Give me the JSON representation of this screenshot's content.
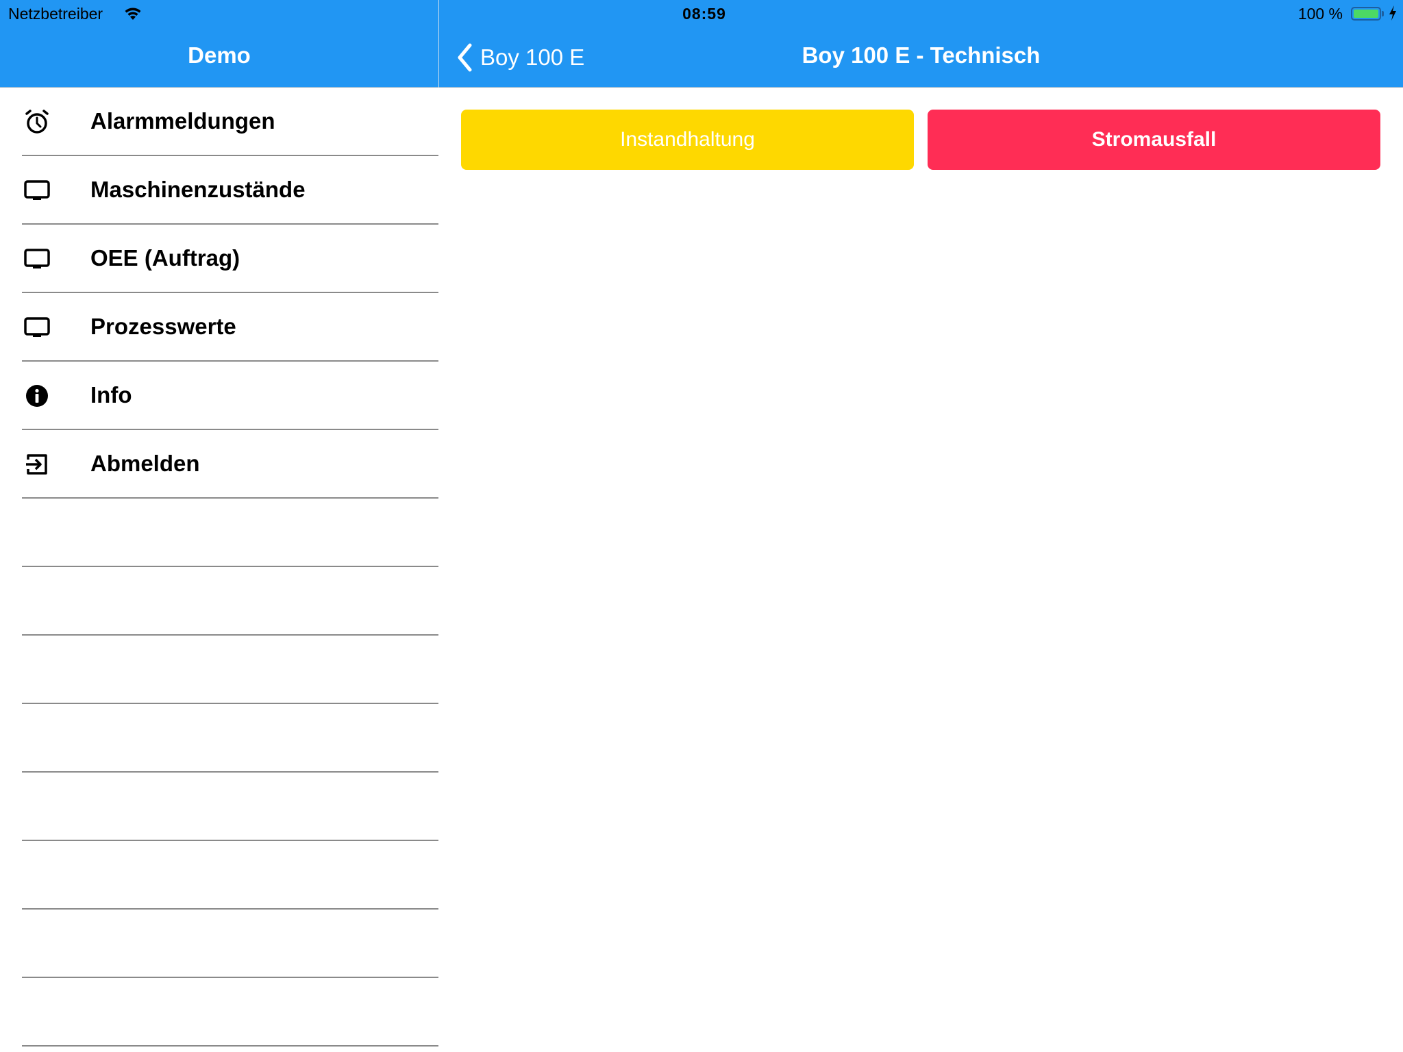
{
  "status_bar": {
    "carrier": "Netzbetreiber",
    "wifi_icon": "wifi-icon",
    "time": "08:59",
    "battery_percent_label": "100 %",
    "battery_level": 1.0,
    "charging_icon": "bolt-icon"
  },
  "colors": {
    "header_blue": "#2196f3",
    "maintenance_yellow": "#fed800",
    "power_failure_red": "#ff2d55",
    "battery_green": "#4cd964"
  },
  "sidebar": {
    "title": "Demo",
    "items": [
      {
        "label": "Alarmmeldungen",
        "icon": "alarm-clock-icon"
      },
      {
        "label": "Maschinenzustände",
        "icon": "monitor-icon"
      },
      {
        "label": "OEE (Auftrag)",
        "icon": "monitor-icon"
      },
      {
        "label": "Prozesswerte",
        "icon": "monitor-icon"
      },
      {
        "label": "Info",
        "icon": "info-icon"
      },
      {
        "label": "Abmelden",
        "icon": "logout-icon"
      }
    ]
  },
  "detail": {
    "back_label": "Boy 100 E",
    "title": "Boy 100 E - Technisch",
    "buttons": [
      {
        "label": "Instandhaltung",
        "color": "#fed800"
      },
      {
        "label": "Stromausfall",
        "color": "#ff2d55"
      }
    ]
  }
}
